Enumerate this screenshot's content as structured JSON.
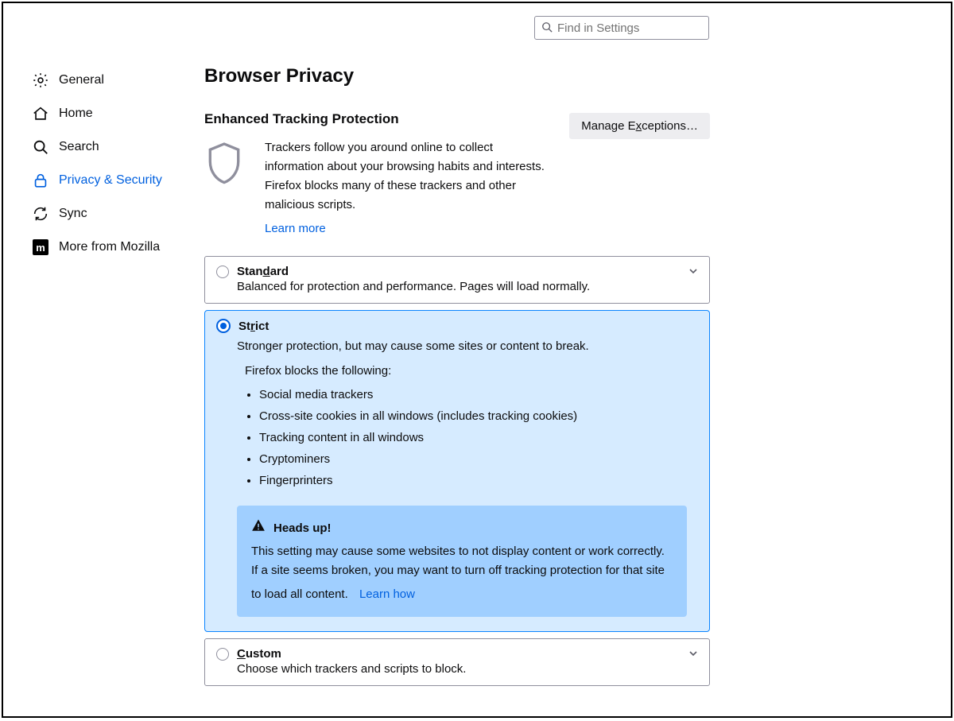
{
  "search": {
    "placeholder": "Find in Settings"
  },
  "sidebar": {
    "items": [
      {
        "label": "General"
      },
      {
        "label": "Home"
      },
      {
        "label": "Search"
      },
      {
        "label": "Privacy & Security"
      },
      {
        "label": "Sync"
      },
      {
        "label": "More from Mozilla"
      }
    ]
  },
  "page": {
    "title": "Browser Privacy",
    "etp": {
      "heading": "Enhanced Tracking Protection",
      "description": "Trackers follow you around online to collect information about your browsing habits and interests. Firefox blocks many of these trackers and other malicious scripts.",
      "learn_more": "Learn more",
      "manage_exceptions": "Manage Exceptions…",
      "manage_exceptions_accesskey": "x",
      "standard": {
        "label": "Standard",
        "accesskey": "d",
        "desc": "Balanced for protection and performance. Pages will load normally."
      },
      "strict": {
        "label": "Strict",
        "accesskey": "r",
        "desc": "Stronger protection, but may cause some sites or content to break.",
        "blocks_label": "Firefox blocks the following:",
        "blocks": [
          "Social media trackers",
          "Cross-site cookies in all windows (includes tracking cookies)",
          "Tracking content in all windows",
          "Cryptominers",
          "Fingerprinters"
        ],
        "callout": {
          "title": "Heads up!",
          "body": "This setting may cause some websites to not display content or work correctly. If a site seems broken, you may want to turn off tracking protection for that site to load all content.",
          "learn_how": "Learn how"
        }
      },
      "custom": {
        "label": "Custom",
        "accesskey": "C",
        "desc": "Choose which trackers and scripts to block."
      }
    }
  }
}
